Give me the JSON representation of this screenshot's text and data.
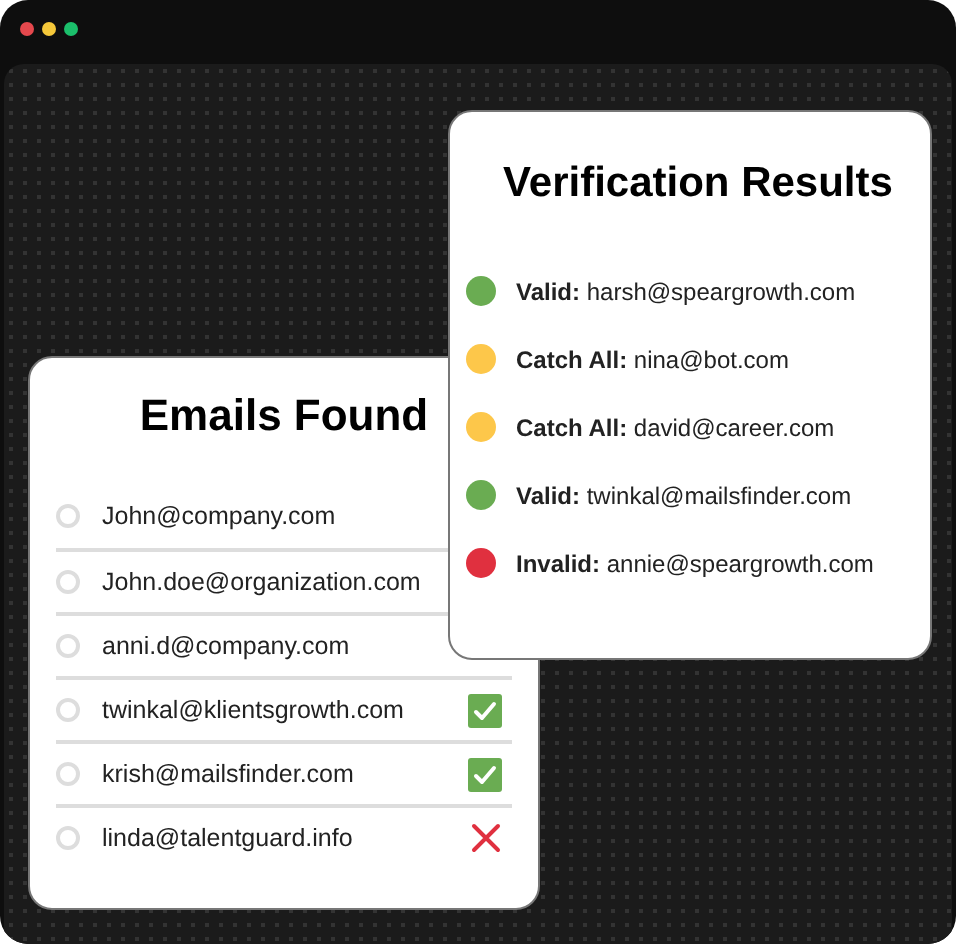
{
  "window": {
    "controls": [
      {
        "color": "#e5484d"
      },
      {
        "color": "#f5c83a"
      },
      {
        "color": "#1bbf6b"
      }
    ]
  },
  "emails_found": {
    "title": "Emails Found",
    "rows": [
      {
        "email": "John@company.com",
        "kind": "none",
        "selected": false
      },
      {
        "email": "John.doe@organization.com",
        "kind": "none",
        "selected": false
      },
      {
        "email": "anni.d@company.com",
        "kind": "none",
        "selected": false
      },
      {
        "email": "twinkal@klientsgrowth.com",
        "kind": "valid",
        "selected": false
      },
      {
        "email": "krish@mailsfinder.com",
        "kind": "valid",
        "selected": false
      },
      {
        "email": "linda@talentguard.info",
        "kind": "invalid",
        "selected": false
      }
    ]
  },
  "verification_results": {
    "title": "Verification Results",
    "rows": [
      {
        "text": "**Valid:** harsh@speargrowth.com",
        "color": "#6aac52"
      },
      {
        "text": "**Catch All:** nina@bot.com",
        "color": "#fdc74a"
      },
      {
        "text": "**Catch All:** david@career.com",
        "color": "#fdc74a"
      },
      {
        "text": "**Valid:** twinkal@mailsfinder.com",
        "color": "#6aac52"
      },
      {
        "text": "**Invalid:** annie@speargrowth.com",
        "color": "#e0303f"
      }
    ]
  }
}
